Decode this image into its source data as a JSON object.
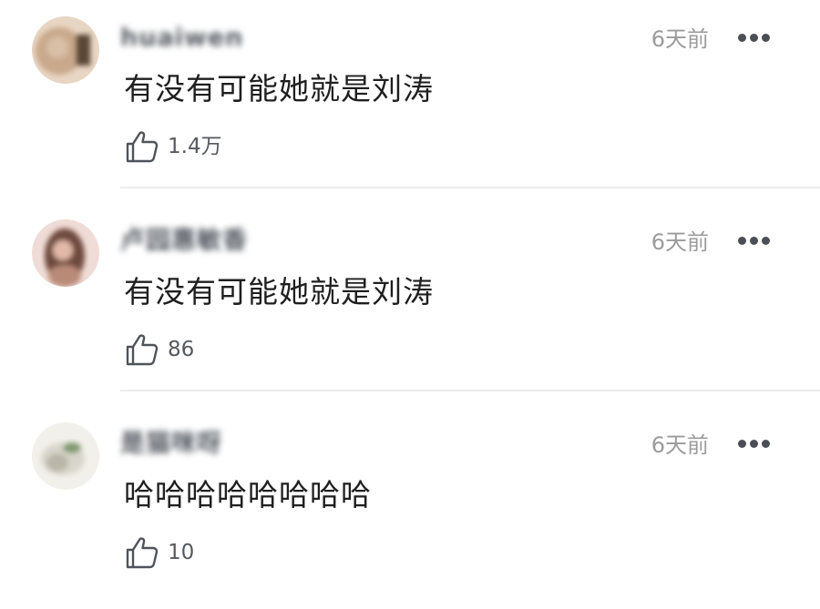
{
  "comments": [
    {
      "username": "huaiwen",
      "time": "6天前",
      "content": "有没有可能她就是刘涛",
      "likes": "1.4万",
      "avatar_colors": [
        "#c9a98b",
        "#8c6c52",
        "#e8d6c4"
      ]
    },
    {
      "username": "卢园惠敏香",
      "time": "6天前",
      "content": "有没有可能她就是刘涛",
      "likes": "86",
      "avatar_colors": [
        "#b98a78",
        "#6e4a3e",
        "#f0dcd6"
      ]
    },
    {
      "username": "是猫咪呀",
      "time": "6天前",
      "content": "哈哈哈哈哈哈哈哈",
      "likes": "10",
      "avatar_colors": [
        "#d8d6cc",
        "#7f9a6e",
        "#f2f0ea"
      ]
    }
  ],
  "icons": {
    "like": "thumbs-up-icon",
    "more": "more-options-icon"
  },
  "colors": {
    "text_primary": "#1f1f1f",
    "text_secondary": "#9b9b9b",
    "divider": "#ececec"
  }
}
